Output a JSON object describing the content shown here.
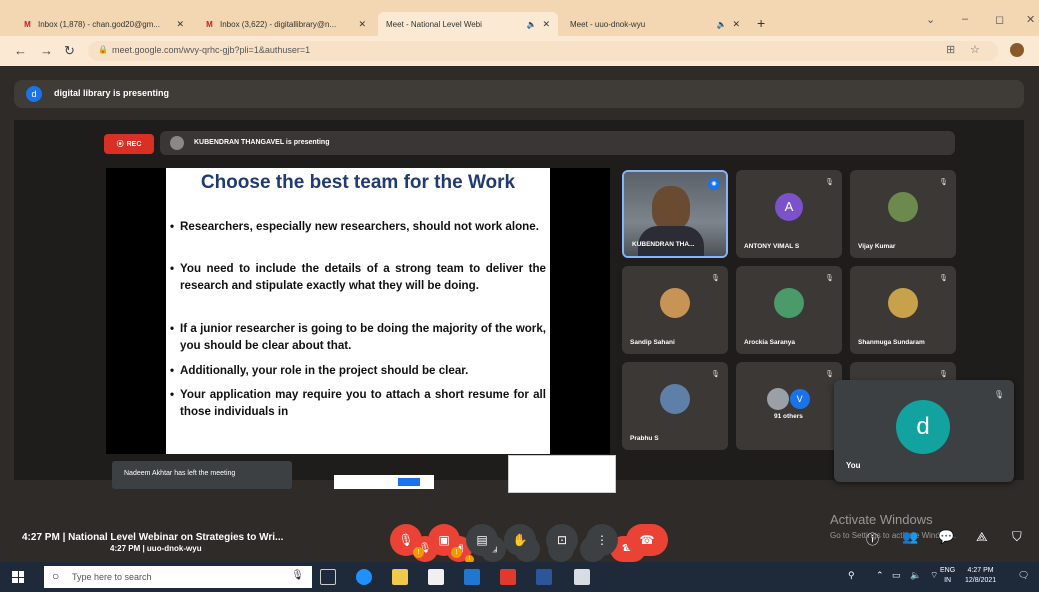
{
  "browser": {
    "tabs": [
      {
        "icon": "gmail-icon",
        "label": "Inbox (1,878) - chan.god20@gm..."
      },
      {
        "icon": "gmail-icon",
        "label": "Inbox (3,622) - digitallibrary@n..."
      },
      {
        "icon": "meet-icon",
        "label": "Meet - National Level Webi"
      },
      {
        "icon": "meet-icon",
        "label": "Meet - uuo-dnok-wyu"
      }
    ],
    "new_tab": "+",
    "url": "meet.google.com/wvy-qrhc-gjb?pli=1&authuser=1"
  },
  "meet": {
    "banner_avatar": "d",
    "banner_text": "digital library is presenting",
    "inner": {
      "rec_label": "REC",
      "presenting_text": "KUBENDRAN THANGAVEL is presenting",
      "slide": {
        "title": "Choose the best team for the Work",
        "bullets": [
          "Researchers, especially new researchers, should not work alone.",
          "You need to include the details of a strong team to deliver the research and stipulate exactly what they will be doing.",
          "If a junior researcher is going to be doing the majority of the work, you should be clear about that.",
          "Additionally, your role in the project should be clear.",
          "Your application may require you to attach a short resume for all those individuals in"
        ]
      },
      "toast": "Nadeem Akhtar has left the meeting",
      "participants": [
        {
          "name": "KUBENDRAN THA...",
          "type": "video"
        },
        {
          "name": "ANTONY VIMAL S",
          "type": "letter",
          "letter": "A"
        },
        {
          "name": "Vijay Kumar",
          "type": "photo",
          "color": "#6d8a4e"
        },
        {
          "name": "Sandip Sahani",
          "type": "photo",
          "color": "#c89455"
        },
        {
          "name": "Arockia Saranya",
          "type": "photo",
          "color": "#4a9a6a"
        },
        {
          "name": "Shanmuga Sundaram",
          "type": "photo",
          "color": "#c7a24a"
        },
        {
          "name": "Prabhu S",
          "type": "photo",
          "color": "#5d7fa8"
        },
        {
          "name": "91 others",
          "type": "others",
          "letter": "V"
        }
      ],
      "self": {
        "letter": "d",
        "label": "You"
      },
      "time_code": "4:27 PM  |  uuo-dnok-wyu"
    },
    "outer": {
      "time_title": "4:27 PM  |  National Level Webinar on Strategies to Wri...",
      "activate_title": "Activate Windows",
      "activate_sub": "Go to Settings to activate Windows."
    }
  },
  "taskbar": {
    "search_placeholder": "Type here to search",
    "lang": "ENG",
    "lang_sub": "IN",
    "time": "4:27 PM",
    "date": "12/8/2021"
  },
  "colors": {
    "accent": "#1a73e8",
    "end_call": "#ea4335",
    "rec": "#d93025",
    "self_avatar": "#12a2a0"
  }
}
